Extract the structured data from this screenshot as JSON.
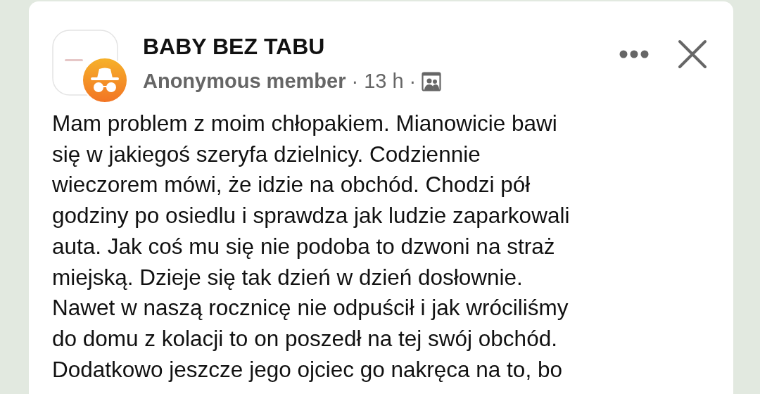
{
  "post": {
    "group_name": "BABY BEZ TABU",
    "author": "Anonymous member",
    "separator_1": "·",
    "time": "13 h",
    "separator_2": "·",
    "body_lines": [
      "Mam problem z moim chłopakiem. Mianowicie bawi",
      "się w jakiegoś szeryfa dzielnicy. Codziennie",
      "wieczorem mówi, że idzie na obchód. Chodzi pół",
      "godziny po osiedlu i sprawdza jak ludzie zaparkowali",
      "auta. Jak coś mu się nie podoba to dzwoni na straż",
      "miejską. Dzieje się tak dzień w dzień dosłownie.",
      "Nawet w naszą rocznicę nie odpuścił i jak wróciliśmy",
      "do domu z kolacji to on poszedł na tej swój obchód.",
      "Dodatkowo jeszcze jego ojciec go nakręca na to, bo"
    ]
  }
}
